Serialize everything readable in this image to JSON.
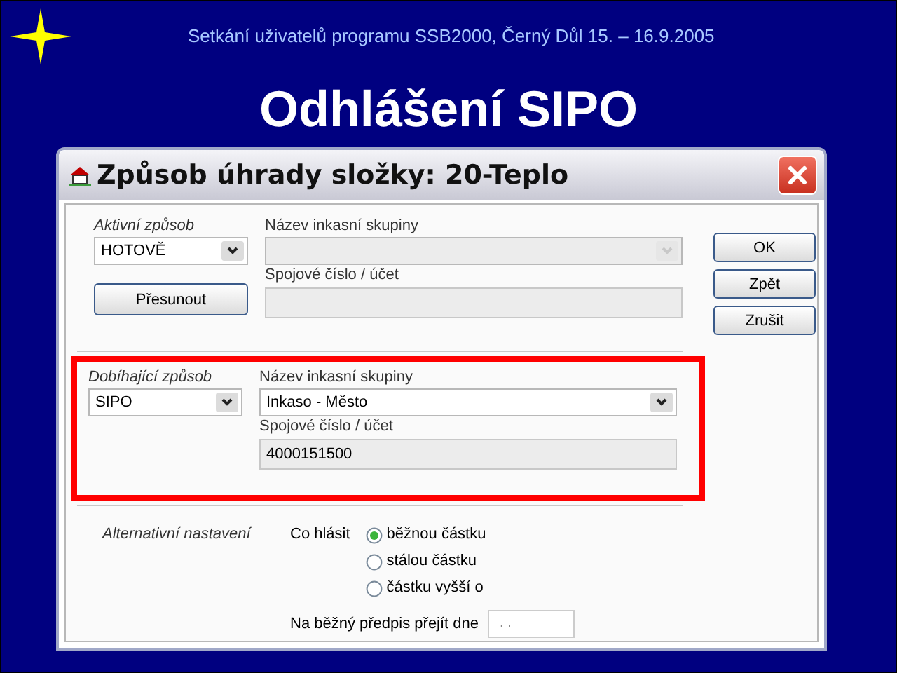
{
  "slide": {
    "header": "Setkání uživatelů programu SSB2000, Černý Důl 15. – 16.9.2005",
    "title": "Odhlášení SIPO"
  },
  "dialog": {
    "title": "Způsob úhrady složky: 20-Teplo",
    "sections": [
      {
        "method_label": "Aktivní způsob",
        "method_value": "HOTOVĚ",
        "button": "Přesunout",
        "group_label": "Název inkasní skupiny",
        "account_label": "Spojové číslo / účet",
        "disabled": true,
        "highlighted": false
      },
      {
        "method_label": "Dobíhající způsob",
        "method_value": "SIPO",
        "group_label": "Název inkasní skupiny",
        "group_value": "Inkaso - Město",
        "account_label": "Spojové číslo / účet",
        "account_value": "4000151500",
        "disabled": false,
        "highlighted": true
      }
    ],
    "buttons": [
      "OK",
      "Zpět",
      "Zrušit"
    ],
    "alternative": {
      "label": "Alternativní nastavení",
      "report_label": "Co hlásit",
      "options": [
        {
          "label": "běžnou částku",
          "selected": true
        },
        {
          "label": "stálou částku",
          "selected": false
        },
        {
          "label": "částku vyšší o",
          "selected": false
        }
      ],
      "date_label": "Na běžný předpis přejít dne",
      "date_value": ". ."
    }
  }
}
